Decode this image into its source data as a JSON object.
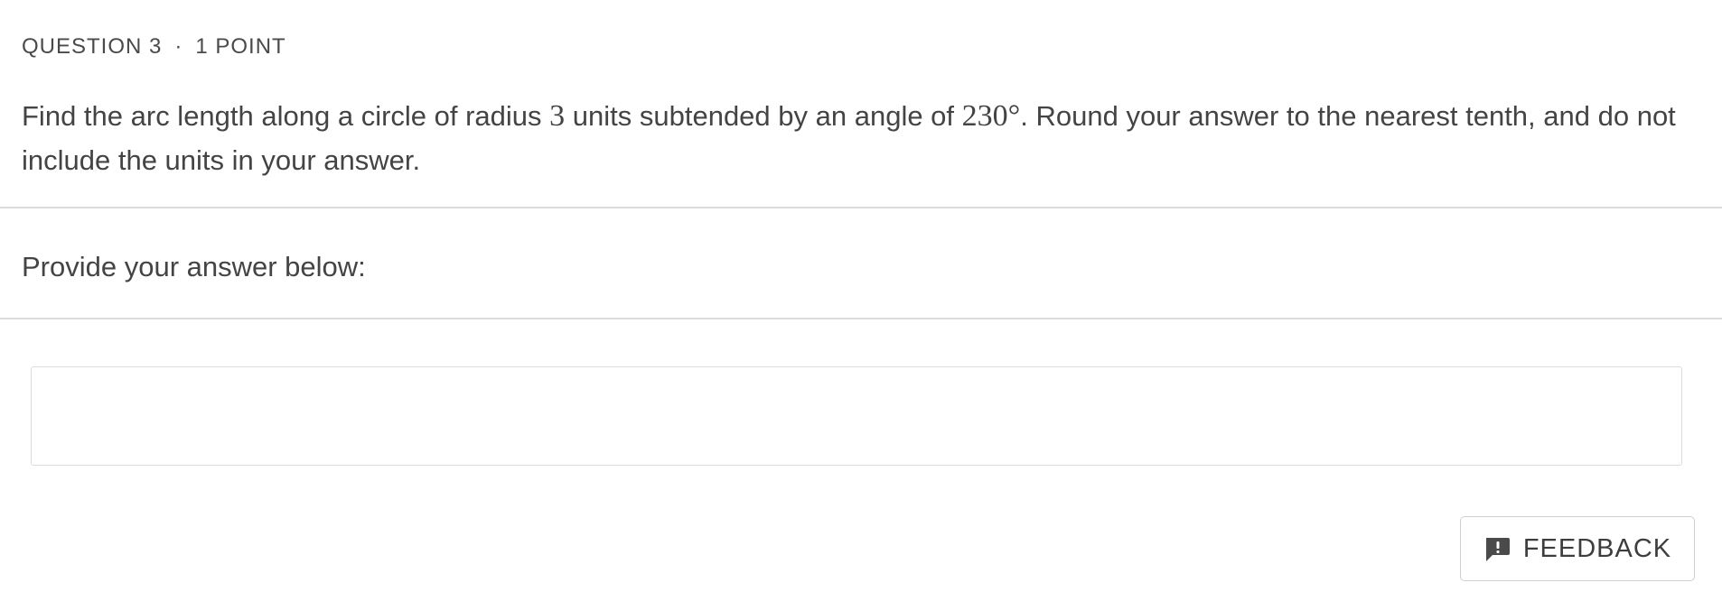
{
  "question": {
    "number_label": "QUESTION 3",
    "separator": "·",
    "points_label": "1 POINT",
    "text_part1": "Find the arc length along a circle of radius ",
    "radius_value": "3",
    "text_part2": " units subtended by an angle of ",
    "angle_value": "230°",
    "text_part3": ". Round your answer to the nearest tenth, and do not include the units in your answer."
  },
  "answer": {
    "prompt": "Provide your answer below:",
    "value": "",
    "placeholder": ""
  },
  "feedback": {
    "label": "FEEDBACK",
    "icon": "feedback-alert-icon"
  },
  "colors": {
    "text": "#444444",
    "divider": "#dcdcdc",
    "border": "#cfcfcf"
  }
}
